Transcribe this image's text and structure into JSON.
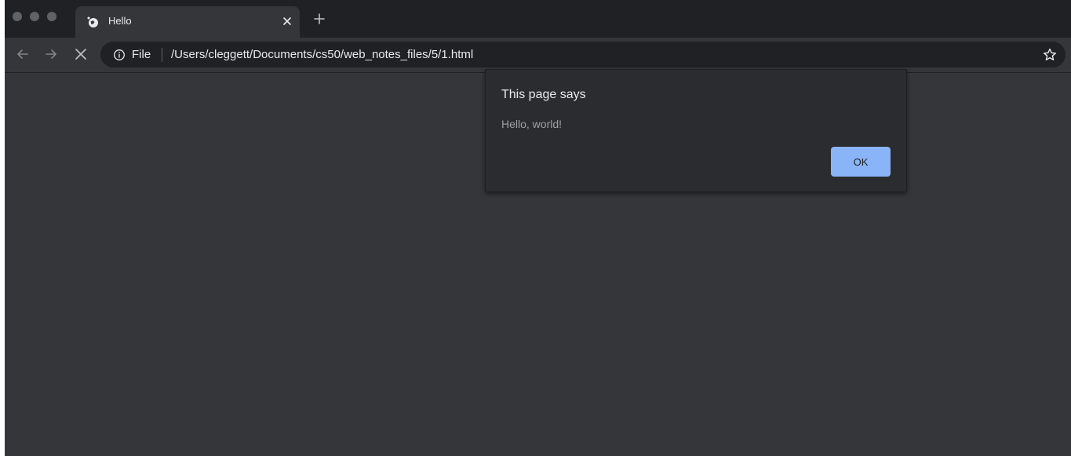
{
  "tab": {
    "title": "Hello",
    "favicon_icon": "globe-icon"
  },
  "toolbar": {
    "back_icon": "back-arrow-icon",
    "forward_icon": "forward-arrow-icon",
    "stop_icon": "close-icon"
  },
  "omnibox": {
    "scheme": "File",
    "url": "/Users/cleggett/Documents/cs50/web_notes_files/5/1.html",
    "info_icon": "info-icon",
    "bookmark_icon": "star-icon"
  },
  "dialog": {
    "title": "This page says",
    "message": "Hello, world!",
    "ok_label": "OK"
  },
  "colors": {
    "tabstrip": "#202124",
    "toolbar": "#35363a",
    "content": "#35363a",
    "dialog_bg": "#2b2c2f",
    "accent": "#8ab4f8"
  }
}
